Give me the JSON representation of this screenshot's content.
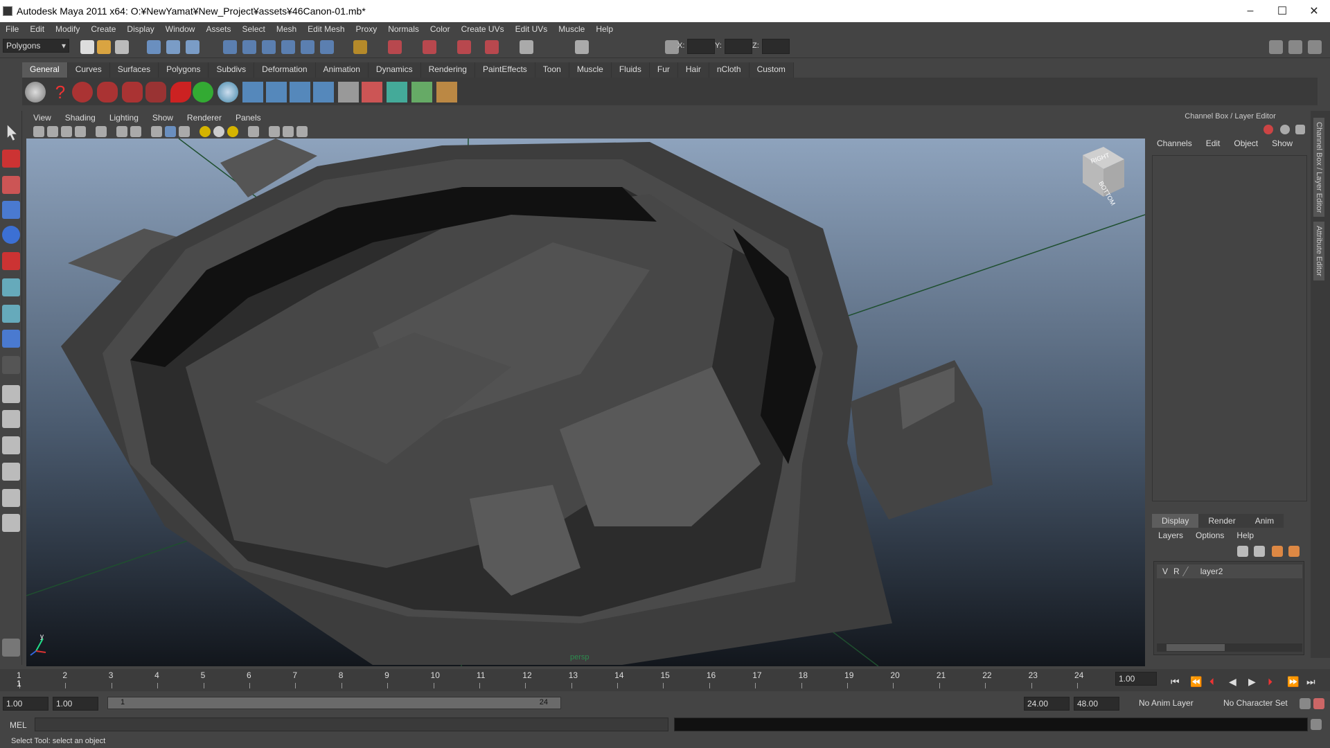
{
  "window": {
    "title": "Autodesk Maya 2011 x64: O:¥NewYamat¥New_Project¥assets¥46Canon-01.mb*",
    "minimize": "–",
    "maximize": "☐",
    "close": "✕"
  },
  "menubar": [
    "File",
    "Edit",
    "Modify",
    "Create",
    "Display",
    "Window",
    "Assets",
    "Select",
    "Mesh",
    "Edit Mesh",
    "Proxy",
    "Normals",
    "Color",
    "Create UVs",
    "Edit UVs",
    "Muscle",
    "Help"
  ],
  "statusline": {
    "mode": "Polygons",
    "x_label": "X:",
    "y_label": "Y:",
    "z_label": "Z:"
  },
  "shelf": {
    "tabs": [
      "General",
      "Curves",
      "Surfaces",
      "Polygons",
      "Subdivs",
      "Deformation",
      "Animation",
      "Dynamics",
      "Rendering",
      "PaintEffects",
      "Toon",
      "Muscle",
      "Fluids",
      "Fur",
      "Hair",
      "nCloth",
      "Custom"
    ],
    "active_tab": "General"
  },
  "viewport": {
    "menu": [
      "View",
      "Shading",
      "Lighting",
      "Show",
      "Renderer",
      "Panels"
    ],
    "viewcube_top": "RIGHT",
    "viewcube_side": "BOTTOM",
    "camera_label": "persp",
    "axis_y": "y"
  },
  "channel_box": {
    "title": "Channel Box / Layer Editor",
    "menu": [
      "Channels",
      "Edit",
      "Object",
      "Show"
    ],
    "layer_tabs": [
      "Display",
      "Render",
      "Anim"
    ],
    "active_layer_tab": "Display",
    "layer_menu": [
      "Layers",
      "Options",
      "Help"
    ],
    "layers": [
      {
        "v": "V",
        "r": "R",
        "name": "layer2"
      }
    ],
    "side_tabs": [
      "Channel Box / Layer Editor",
      "Attribute Editor"
    ]
  },
  "timeline": {
    "ticks": [
      "1",
      "2",
      "3",
      "4",
      "5",
      "6",
      "7",
      "8",
      "9",
      "10",
      "11",
      "12",
      "13",
      "14",
      "15",
      "16",
      "17",
      "18",
      "19",
      "20",
      "21",
      "22",
      "23",
      "24"
    ],
    "current_frame_label": "1",
    "current_time": "1.00",
    "playback_buttons": [
      "⏮",
      "⏭",
      "|◀",
      "◀",
      "▶",
      "▶|",
      "⏭",
      "▶▶|"
    ]
  },
  "range": {
    "start_time": "1.00",
    "playback_start": "1.00",
    "slider_start": "1",
    "slider_end": "24",
    "playback_end": "24.00",
    "end_time": "48.00",
    "anim_layer": "No Anim Layer",
    "character_set": "No Character Set"
  },
  "commandline": {
    "label": "MEL"
  },
  "helpline": "Select Tool: select an object"
}
